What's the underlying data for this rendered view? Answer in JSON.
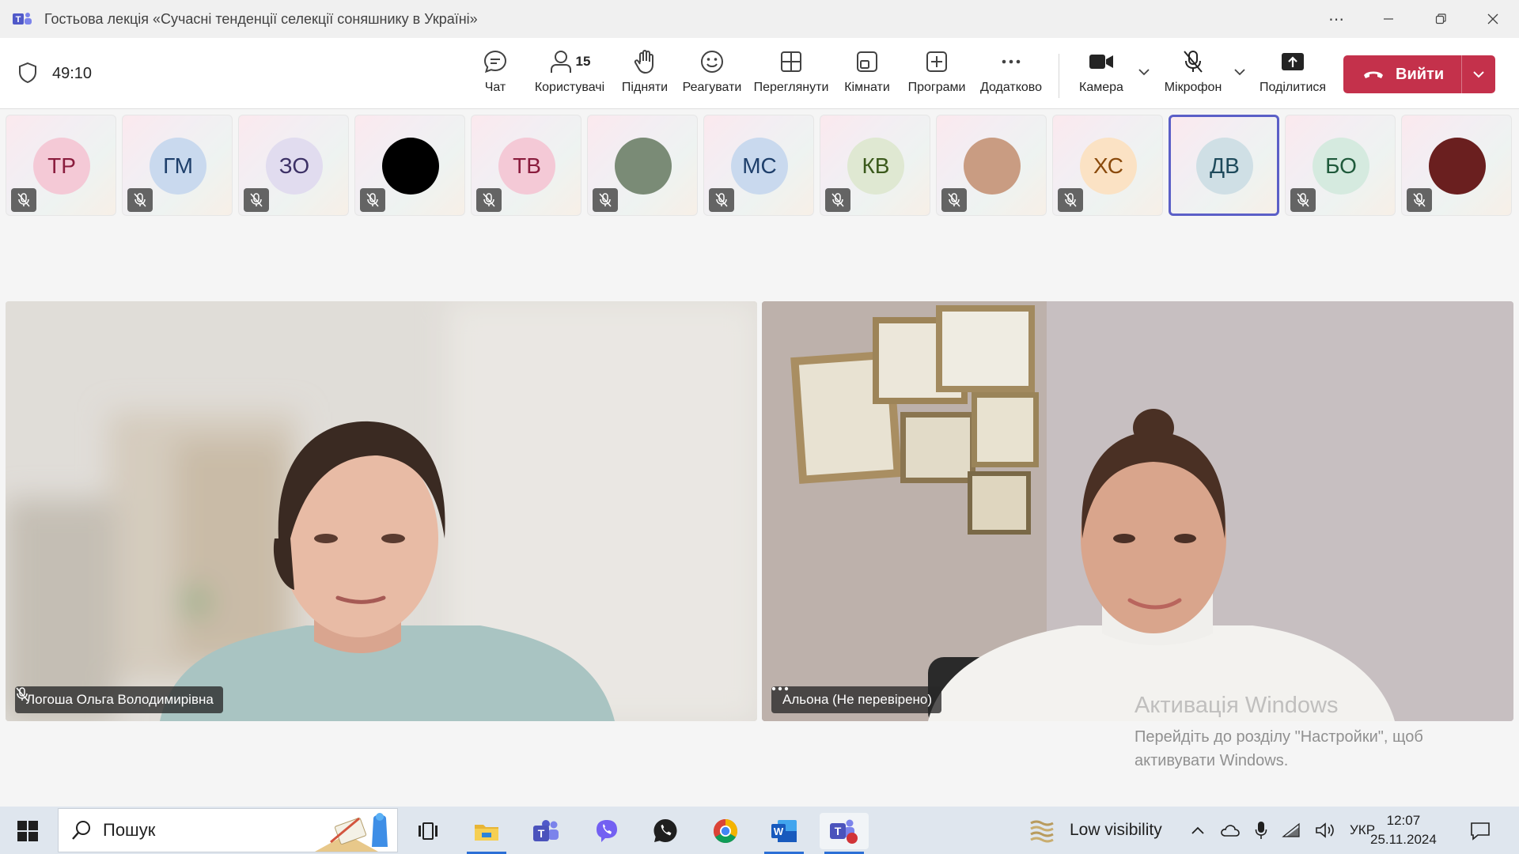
{
  "window": {
    "title": "Гостьова лекція «Сучасні тенденції селекції соняшнику в Україні»"
  },
  "toolbar": {
    "timer": "49:10",
    "chat_label": "Чат",
    "people_label": "Користувачі",
    "people_count": "15",
    "raise_label": "Підняти",
    "react_label": "Реагувати",
    "view_label": "Переглянути",
    "rooms_label": "Кімнати",
    "apps_label": "Програми",
    "more_label": "Додатково",
    "camera_label": "Камера",
    "mic_label": "Мікрофон",
    "share_label": "Поділитися",
    "leave_label": "Вийти"
  },
  "participants": [
    {
      "initials": "ТР",
      "color": "#f4c9d6",
      "text_color": "#8a1c3d"
    },
    {
      "initials": "ГМ",
      "color": "#c9d9ee",
      "text_color": "#1e3f6b"
    },
    {
      "initials": "ЗО",
      "color": "#e1dcef",
      "text_color": "#3d3166"
    },
    {
      "initials": "",
      "color": "#000000",
      "text_color": "#ffffff"
    },
    {
      "initials": "ТВ",
      "color": "#f4c9d6",
      "text_color": "#8a1c3d"
    },
    {
      "initials": "",
      "color": "#7a8b76",
      "text_color": "#ffffff"
    },
    {
      "initials": "МС",
      "color": "#c9d9ee",
      "text_color": "#1e3f6b"
    },
    {
      "initials": "КВ",
      "color": "#dfe8d2",
      "text_color": "#3b5a1c"
    },
    {
      "initials": "",
      "color": "#c99c82",
      "text_color": "#ffffff"
    },
    {
      "initials": "ХС",
      "color": "#fbe2c4",
      "text_color": "#8a4a0c"
    },
    {
      "initials": "ДВ",
      "color": "#cfdfe5",
      "text_color": "#1e4a5b"
    },
    {
      "initials": "БО",
      "color": "#d5eadf",
      "text_color": "#1f5a3b"
    },
    {
      "initials": "",
      "color": "#6a1f1f",
      "text_color": "#ffffff"
    }
  ],
  "videos": {
    "left_name": "Логоша Ольга Володимирівна",
    "right_name": "Альона (Не перевірено)"
  },
  "watermark": {
    "line1": "Активація Windows",
    "line2": "Перейдіть до розділу \"Настройки\", щоб",
    "line3": "активувати Windows."
  },
  "taskbar": {
    "search_text": "Пошук",
    "weather": "Low visibility",
    "language": "УКР",
    "time": "12:07",
    "date": "25.11.2024"
  }
}
